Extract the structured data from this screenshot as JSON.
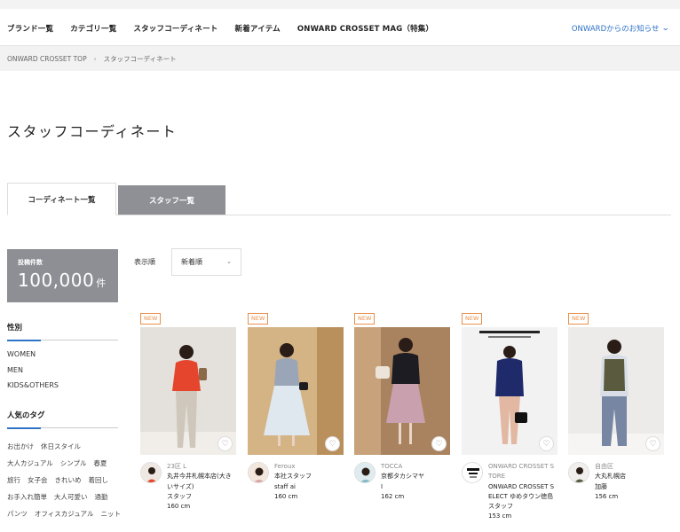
{
  "nav": {
    "items": [
      "ブランド一覧",
      "カテゴリ一覧",
      "スタッフコーディネート",
      "新着アイテム",
      "ONWARD CROSSET MAG（特集）"
    ],
    "notice": "ONWARDからのお知らせ"
  },
  "breadcrumb": {
    "home": "ONWARD CROSSET TOP",
    "separator": "›",
    "current": "スタッフコーディネート"
  },
  "page_title": "スタッフコーディネート",
  "tabs": {
    "coordinates": "コーディネート一覧",
    "staff": "スタッフ一覧"
  },
  "count": {
    "label": "投稿件数",
    "value": "100,000",
    "unit": "件"
  },
  "sidebar": {
    "gender_heading": "性別",
    "gender_items": [
      "WOMEN",
      "MEN",
      "KIDS&OTHERS"
    ],
    "tags_heading": "人気のタグ",
    "tags": [
      "お出かけ",
      "休日スタイル",
      "大人カジュアル",
      "シンプル",
      "春夏",
      "旅行",
      "女子会",
      "きれいめ",
      "着回し",
      "お手入れ簡単",
      "大人可愛い",
      "通勤",
      "パンツ",
      "オフィスカジュアル",
      "ニット"
    ]
  },
  "sort": {
    "label": "表示順",
    "selected": "新着順"
  },
  "badge_label": "NEW",
  "cards": [
    {
      "brand": "23区 L",
      "store": "丸井今井札幌本店(大きいサイズ)",
      "role": "スタッフ",
      "height": "160 cm"
    },
    {
      "brand": "Feroux",
      "store": "本社スタッフ",
      "role": "staff ai",
      "height": "160 cm"
    },
    {
      "brand": "TOCCA",
      "store": "京都タカシマヤ",
      "role": "I",
      "height": "162 cm"
    },
    {
      "brand": "ONWARD CROSSET STORE",
      "store": "ONWARD CROSSET SELECT ゆめタウン徳島",
      "role": "スタッフ",
      "height": "153 cm"
    },
    {
      "brand": "自由区",
      "store": "大丸札幌店",
      "role": "加藤",
      "height": "156 cm"
    }
  ],
  "colors": {
    "accent": "#2f73c6",
    "badge": "#e8904c",
    "count_bg": "#8e8f94"
  },
  "icons": {
    "favorite": "heart-icon",
    "dropdown": "chevron-down-icon"
  }
}
